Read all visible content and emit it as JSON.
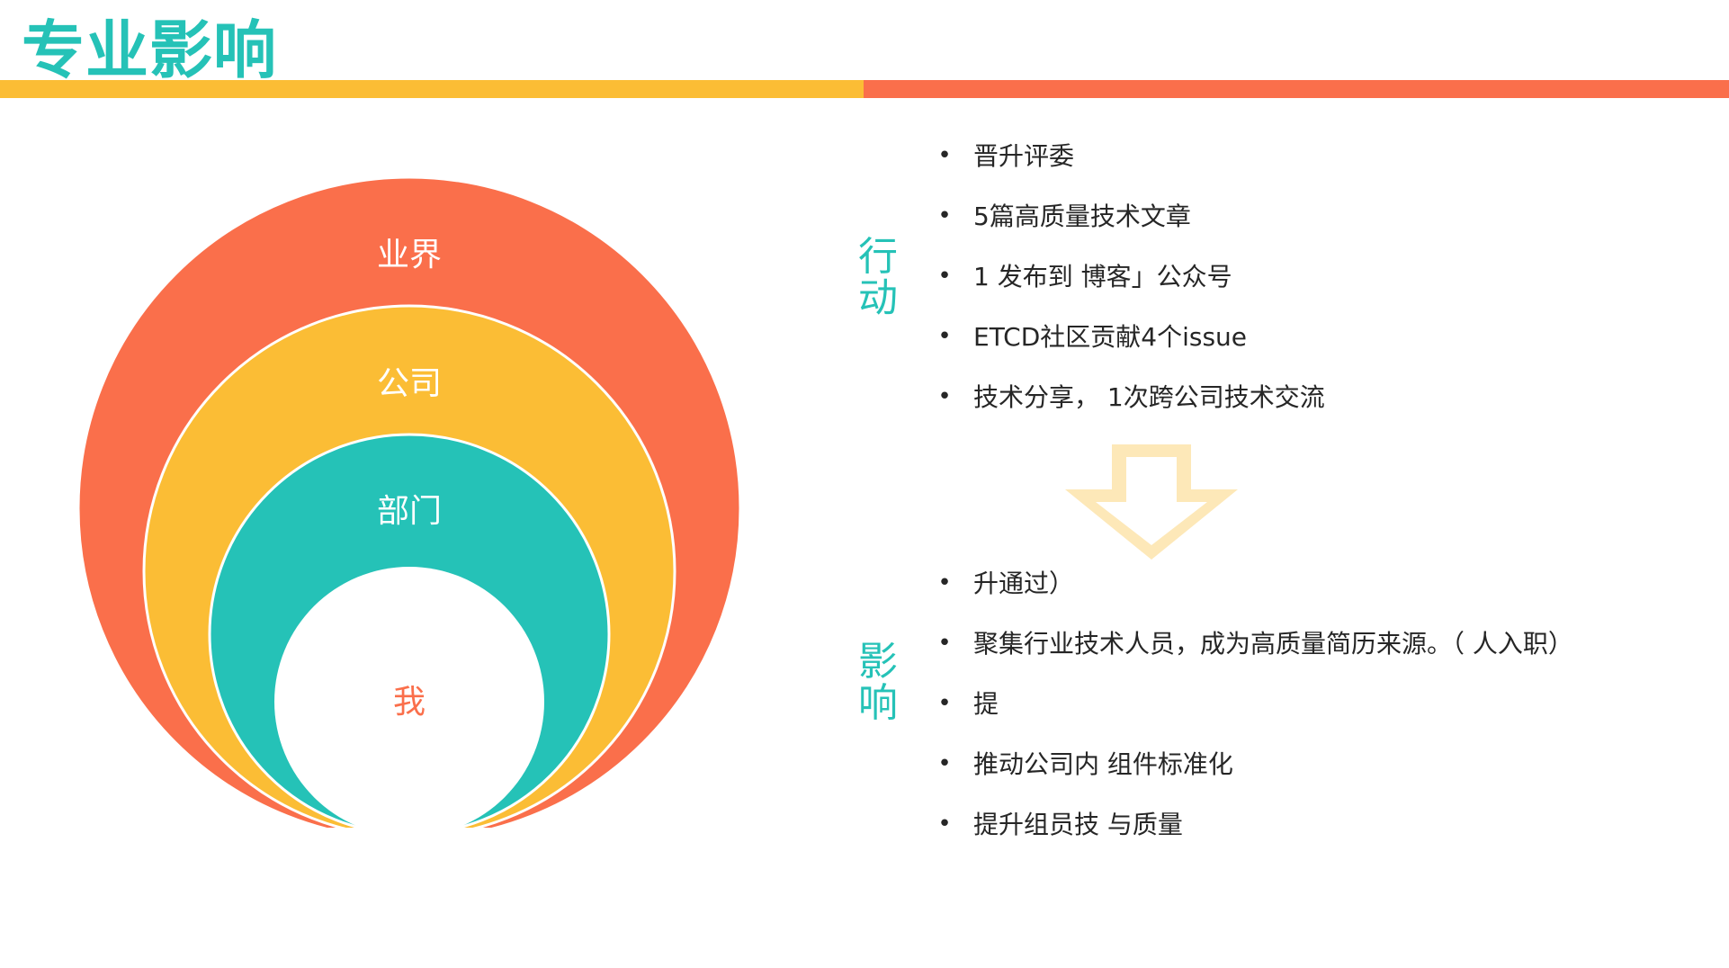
{
  "title": "专业影响",
  "colors": {
    "teal": "#25c2b7",
    "yellow": "#fbbd35",
    "orange": "#fa6f4b",
    "arrow": "#fde8b8"
  },
  "diagram": {
    "rings": [
      {
        "label": "业界",
        "color": "#fa6f4b"
      },
      {
        "label": "公司",
        "color": "#fbbd35"
      },
      {
        "label": "部门",
        "color": "#25c2b7"
      }
    ],
    "center_label": "我"
  },
  "actions": {
    "label": "行动",
    "items": [
      "晋升评委",
      "5篇高质量技术文章",
      "1 发布到 博客」公众号",
      "ETCD社区贡献4个issue",
      "技术分享， 1次跨公司技术交流"
    ]
  },
  "arrow_icon": "down-arrow-icon",
  "impact": {
    "label": "影响",
    "items": [
      "升通过）",
      "聚集行业技术人员，成为高质量简历来源。（ 人入职）",
      "提",
      "推动公司内 组件标准化",
      "提升组员技 与质量"
    ]
  }
}
